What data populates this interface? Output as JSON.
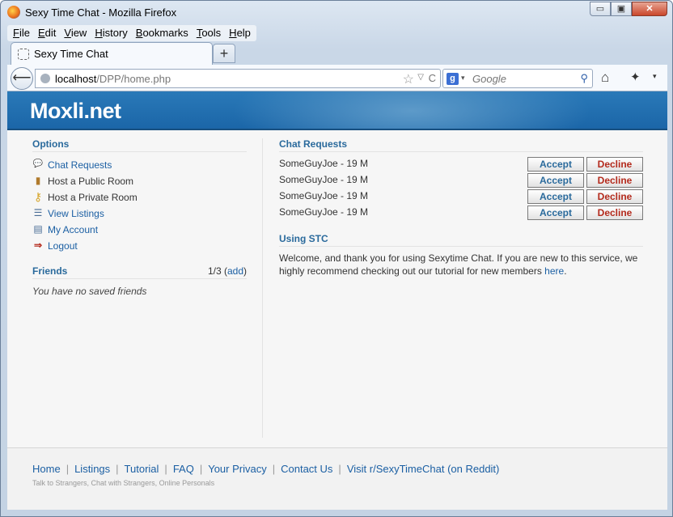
{
  "window": {
    "title": "Sexy Time Chat - Mozilla Firefox",
    "min_glyph": "▭",
    "max_glyph": "▣",
    "close_glyph": "✕"
  },
  "menubar": {
    "items": [
      {
        "first": "F",
        "rest": "ile"
      },
      {
        "first": "E",
        "rest": "dit"
      },
      {
        "first": "V",
        "rest": "iew"
      },
      {
        "first": "H",
        "rest": "istory"
      },
      {
        "first": "B",
        "rest": "ookmarks"
      },
      {
        "first": "T",
        "rest": "ools"
      },
      {
        "first": "H",
        "rest": "elp"
      }
    ]
  },
  "tabs": {
    "active_label": "Sexy Time Chat",
    "new_tab_glyph": "+"
  },
  "navbar": {
    "back_glyph": "⟵",
    "url_host": "localhost",
    "url_path": "/DPP/home.php",
    "star_glyph": "☆",
    "dropdown_glyph": "▽",
    "reload_glyph": "C",
    "search_engine_glyph": "g",
    "search_dropdown_glyph": "▾",
    "search_placeholder": "Google",
    "search_glyph": "⚲",
    "home_glyph": "⌂",
    "addon_glyph": "✦",
    "overflow_glyph": "▾"
  },
  "site": {
    "logo": "Moxli.net"
  },
  "options": {
    "title": "Options",
    "items": [
      {
        "label": "Chat Requests",
        "icon": "speech-bubble-icon",
        "glyph": "💬",
        "link": true
      },
      {
        "label": "Host a Public Room",
        "icon": "door-icon",
        "glyph": "▮",
        "link": false
      },
      {
        "label": "Host a Private Room",
        "icon": "key-icon",
        "glyph": "⚷",
        "link": false
      },
      {
        "label": "View Listings",
        "icon": "list-icon",
        "glyph": "☰",
        "link": true
      },
      {
        "label": "My Account",
        "icon": "id-card-icon",
        "glyph": "▤",
        "link": true
      },
      {
        "label": "Logout",
        "icon": "arrow-right-icon",
        "glyph": "⇒",
        "link": true
      }
    ]
  },
  "friends": {
    "title": "Friends",
    "count": "1/3",
    "add_label": "add",
    "empty_text": "You have no saved friends"
  },
  "chat_requests": {
    "title": "Chat Requests",
    "accept_label": "Accept",
    "decline_label": "Decline",
    "rows": [
      {
        "name": "SomeGuyJoe - 19 M"
      },
      {
        "name": "SomeGuyJoe - 19 M"
      },
      {
        "name": "SomeGuyJoe - 19 M"
      },
      {
        "name": "SomeGuyJoe - 19 M"
      }
    ]
  },
  "using_stc": {
    "title": "Using STC",
    "text": "Welcome, and thank you for using Sexytime Chat. If you are new to this service, we highly recommend checking out our tutorial for new members ",
    "link_text": "here",
    "period": "."
  },
  "footer": {
    "links": [
      "Home",
      "Listings",
      "Tutorial",
      "FAQ",
      "Your Privacy",
      "Contact Us",
      "Visit r/SexyTimeChat (on Reddit)"
    ],
    "tagline": "Talk to Strangers, Chat with Strangers, Online Personals"
  },
  "colors": {
    "banner": "#1b66a8",
    "link": "#1b5fa3",
    "section_title": "#2a6a9c",
    "decline_text": "#b42a1c"
  }
}
